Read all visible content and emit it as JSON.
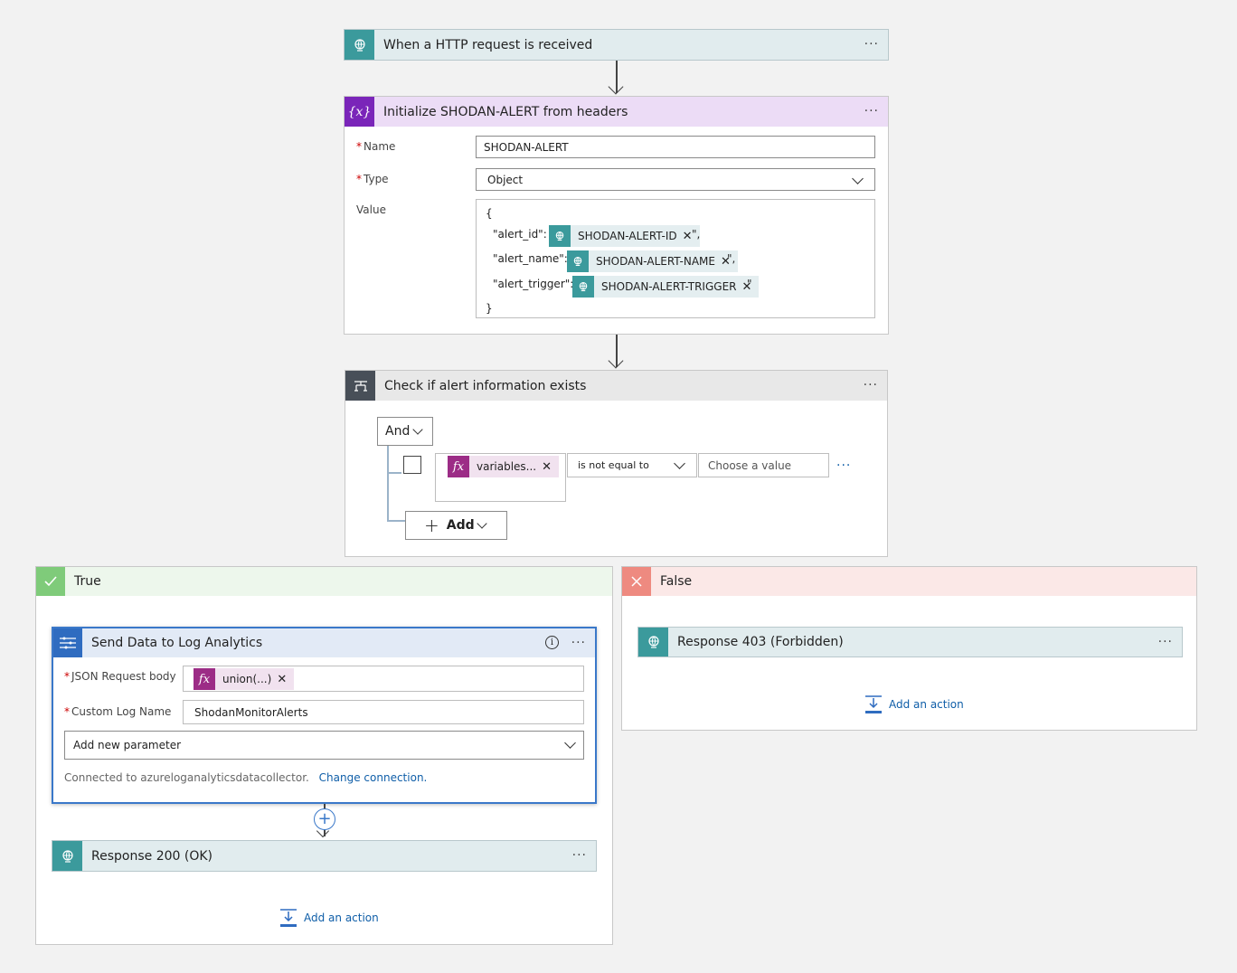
{
  "trigger": {
    "title": "When a HTTP request is received"
  },
  "init": {
    "title": "Initialize SHODAN-ALERT from headers",
    "name_label": "Name",
    "name_value": "SHODAN-ALERT",
    "type_label": "Type",
    "type_value": "Object",
    "value_label": "Value",
    "value_lines": {
      "open": "{",
      "alert_id_key": "\"alert_id\": \"",
      "alert_id_token": "SHODAN-ALERT-ID",
      "alert_id_suffix": "\",",
      "alert_name_key": "\"alert_name\": \"",
      "alert_name_token": "SHODAN-ALERT-NAME",
      "alert_name_suffix": "\",",
      "alert_trigger_key": "\"alert_trigger\": \"",
      "alert_trigger_token": "SHODAN-ALERT-TRIGGER",
      "alert_trigger_suffix": "\"",
      "close": "}"
    }
  },
  "condition": {
    "title": "Check if alert information exists",
    "group_operator": "And",
    "left_token": "variables...",
    "operator": "is not equal to",
    "right_placeholder": "Choose a value",
    "add_label": "Add"
  },
  "true_branch": {
    "title": "True",
    "send": {
      "title": "Send Data to Log Analytics",
      "json_label": "JSON Request body",
      "json_token": "union(...)",
      "log_label": "Custom Log Name",
      "log_value": "ShodanMonitorAlerts",
      "add_param": "Add new parameter",
      "connected_text": "Connected to azureloganalyticsdatacollector.",
      "change_link": "Change connection."
    },
    "response": {
      "title": "Response 200 (OK)"
    },
    "add_action": "Add an action"
  },
  "false_branch": {
    "title": "False",
    "response": {
      "title": "Response 403 (Forbidden)"
    },
    "add_action": "Add an action"
  },
  "colors": {
    "http_teal": "#3b9a9c",
    "http_header_bg": "#e1ecee",
    "variable_purple": "#7a25b9",
    "variable_header_bg": "#ecdcf6",
    "condition_dark": "#484f58",
    "condition_header_bg": "#e8e8e8",
    "true_green": "#7fcb7a",
    "true_header_bg": "#edf7ec",
    "false_red": "#ee8a80",
    "false_header_bg": "#fbe8e7",
    "loganalytics_blue": "#2f6cc0",
    "loganalytics_header_bg": "#e2eaf6",
    "link_blue": "#0f5ea8"
  }
}
